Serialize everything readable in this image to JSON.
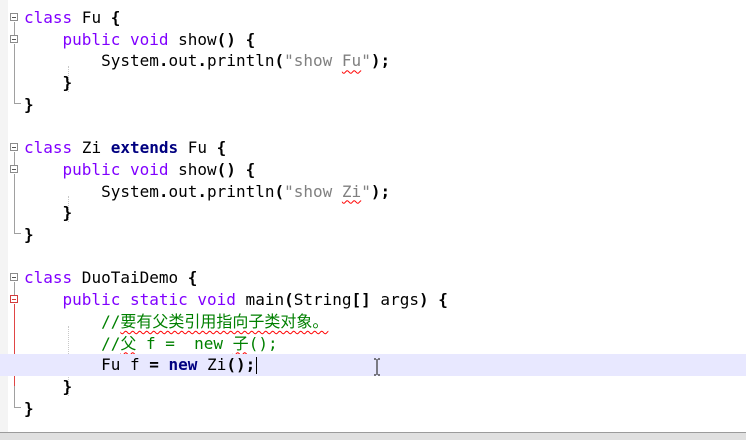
{
  "editor": {
    "lines": [
      {
        "tokens": [
          {
            "t": "kw",
            "v": "class"
          },
          {
            "t": "plain",
            "v": " Fu "
          },
          {
            "t": "op",
            "v": "{"
          }
        ]
      },
      {
        "tokens": [
          {
            "t": "plain",
            "v": "    "
          },
          {
            "t": "kw",
            "v": "public void"
          },
          {
            "t": "plain",
            "v": " show"
          },
          {
            "t": "op",
            "v": "()"
          },
          {
            "t": "plain",
            "v": " "
          },
          {
            "t": "op",
            "v": "{"
          }
        ]
      },
      {
        "tokens": [
          {
            "t": "plain",
            "v": "        System"
          },
          {
            "t": "op",
            "v": "."
          },
          {
            "t": "plain",
            "v": "out"
          },
          {
            "t": "op",
            "v": "."
          },
          {
            "t": "plain",
            "v": "println"
          },
          {
            "t": "op",
            "v": "("
          },
          {
            "t": "str",
            "v": "\"show "
          },
          {
            "t": "str-sq",
            "v": "Fu"
          },
          {
            "t": "str",
            "v": "\""
          },
          {
            "t": "op",
            "v": ");"
          }
        ]
      },
      {
        "tokens": [
          {
            "t": "plain",
            "v": "    "
          },
          {
            "t": "op",
            "v": "}"
          }
        ]
      },
      {
        "tokens": [
          {
            "t": "op",
            "v": "}"
          }
        ]
      },
      {
        "tokens": []
      },
      {
        "tokens": [
          {
            "t": "kw",
            "v": "class"
          },
          {
            "t": "plain",
            "v": " Zi "
          },
          {
            "t": "kwb",
            "v": "extends"
          },
          {
            "t": "plain",
            "v": " Fu "
          },
          {
            "t": "op",
            "v": "{"
          }
        ]
      },
      {
        "tokens": [
          {
            "t": "plain",
            "v": "    "
          },
          {
            "t": "kw",
            "v": "public void"
          },
          {
            "t": "plain",
            "v": " show"
          },
          {
            "t": "op",
            "v": "()"
          },
          {
            "t": "plain",
            "v": " "
          },
          {
            "t": "op",
            "v": "{"
          }
        ]
      },
      {
        "tokens": [
          {
            "t": "plain",
            "v": "        System"
          },
          {
            "t": "op",
            "v": "."
          },
          {
            "t": "plain",
            "v": "out"
          },
          {
            "t": "op",
            "v": "."
          },
          {
            "t": "plain",
            "v": "println"
          },
          {
            "t": "op",
            "v": "("
          },
          {
            "t": "str",
            "v": "\"show "
          },
          {
            "t": "str-sq",
            "v": "Zi"
          },
          {
            "t": "str",
            "v": "\""
          },
          {
            "t": "op",
            "v": ");"
          }
        ]
      },
      {
        "tokens": [
          {
            "t": "plain",
            "v": "    "
          },
          {
            "t": "op",
            "v": "}"
          }
        ]
      },
      {
        "tokens": [
          {
            "t": "op",
            "v": "}"
          }
        ]
      },
      {
        "tokens": []
      },
      {
        "tokens": [
          {
            "t": "kw",
            "v": "class"
          },
          {
            "t": "plain",
            "v": " DuoTaiDemo "
          },
          {
            "t": "op",
            "v": "{"
          }
        ]
      },
      {
        "tokens": [
          {
            "t": "plain",
            "v": "    "
          },
          {
            "t": "kw",
            "v": "public static void"
          },
          {
            "t": "plain",
            "v": " main"
          },
          {
            "t": "op",
            "v": "("
          },
          {
            "t": "plain",
            "v": "String"
          },
          {
            "t": "op",
            "v": "[]"
          },
          {
            "t": "plain",
            "v": " args"
          },
          {
            "t": "op",
            "v": ")"
          },
          {
            "t": "plain",
            "v": " "
          },
          {
            "t": "op",
            "v": "{"
          }
        ]
      },
      {
        "tokens": [
          {
            "t": "plain",
            "v": "        "
          },
          {
            "t": "cmt",
            "v": "//"
          },
          {
            "t": "cmt-sq",
            "v": "要有父类引用指向子类对象。"
          }
        ]
      },
      {
        "tokens": [
          {
            "t": "plain",
            "v": "        "
          },
          {
            "t": "cmt",
            "v": "//"
          },
          {
            "t": "cmt-sq",
            "v": "父"
          },
          {
            "t": "cmt",
            "v": " f =  new "
          },
          {
            "t": "cmt-sq",
            "v": "子"
          },
          {
            "t": "cmt",
            "v": "();"
          }
        ]
      },
      {
        "tokens": [
          {
            "t": "plain",
            "v": "        Fu f "
          },
          {
            "t": "op",
            "v": "="
          },
          {
            "t": "plain",
            "v": " "
          },
          {
            "t": "kwb",
            "v": "new"
          },
          {
            "t": "plain",
            "v": " Zi"
          },
          {
            "t": "op",
            "v": "();"
          }
        ],
        "current": true
      },
      {
        "tokens": [
          {
            "t": "plain",
            "v": "    "
          },
          {
            "t": "op",
            "v": "}"
          }
        ]
      },
      {
        "tokens": [
          {
            "t": "op",
            "v": "}"
          }
        ]
      }
    ]
  }
}
